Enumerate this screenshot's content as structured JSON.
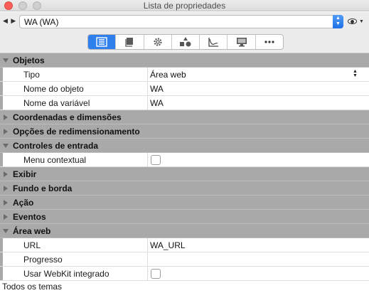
{
  "window": {
    "title": "Lista de propriedades"
  },
  "selector": {
    "nav": "◀ ▶",
    "value": "WA (WA)"
  },
  "toolbar": {
    "tabs": [
      {
        "icon": "list-icon",
        "active": true
      },
      {
        "icon": "book-icon",
        "active": false
      },
      {
        "icon": "gear-icon",
        "active": false
      },
      {
        "icon": "shapes-icon",
        "active": false
      },
      {
        "icon": "graph-icon",
        "active": false
      },
      {
        "icon": "monitor-icon",
        "active": false
      },
      {
        "icon": "more-icon",
        "active": false
      }
    ]
  },
  "grid": {
    "objetos": {
      "label": "Objetos",
      "tipo_name": "Tipo",
      "tipo_value": "Área web",
      "nome_objeto_name": "Nome do objeto",
      "nome_objeto_value": "WA",
      "nome_variavel_name": "Nome da variável",
      "nome_variavel_value": "WA"
    },
    "coordenadas": {
      "label": "Coordenadas e dimensões"
    },
    "redimensionamento": {
      "label": "Opções de redimensionamento"
    },
    "controles": {
      "label": "Controles de entrada",
      "menu_contextual_name": "Menu contextual",
      "menu_contextual_checked": false
    },
    "exibir": {
      "label": "Exibir"
    },
    "fundo": {
      "label": "Fundo e borda"
    },
    "acao": {
      "label": "Ação"
    },
    "eventos": {
      "label": "Eventos"
    },
    "area_web": {
      "label": "Área web",
      "url_name": "URL",
      "url_value": "WA_URL",
      "progresso_name": "Progresso",
      "progresso_value": "",
      "webkit_name": "Usar WebKit integrado",
      "webkit_checked": false
    }
  },
  "footer": {
    "text": "Todos os temas"
  },
  "colors": {
    "accent": "#2f80ed",
    "category_bg": "#a9a9a9",
    "close": "#fc5f57"
  }
}
